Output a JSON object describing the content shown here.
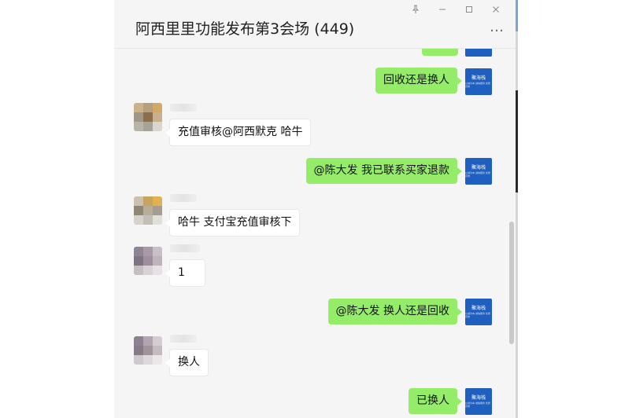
{
  "window": {
    "title": "阿西里里功能发布第3会场 (449)",
    "more_label": "…",
    "controls": [
      "pin-icon",
      "minimize-icon",
      "maximize-icon",
      "close-icon"
    ]
  },
  "self_avatar": {
    "line1": "聚海栈",
    "line2": "以诚为本·诚信服务 优质高效"
  },
  "messages": [
    {
      "side": "out",
      "text": ""
    },
    {
      "side": "out",
      "text": "回收还是换人"
    },
    {
      "side": "in",
      "text": "充值审核@阿西默克   哈牛"
    },
    {
      "side": "out",
      "text": "@陈大发 我已联系买家退款"
    },
    {
      "side": "in",
      "text": "哈牛 支付宝充值审核下"
    },
    {
      "side": "in",
      "text": "1"
    },
    {
      "side": "out",
      "text": "@陈大发 换人还是回收"
    },
    {
      "side": "in",
      "text": "换人"
    },
    {
      "side": "out",
      "text": "已换人"
    }
  ],
  "colors": {
    "outgoing_bubble": "#95ec69",
    "incoming_bubble": "#ffffff",
    "background": "#f5f5f5",
    "self_avatar": "#1f5fbf"
  }
}
